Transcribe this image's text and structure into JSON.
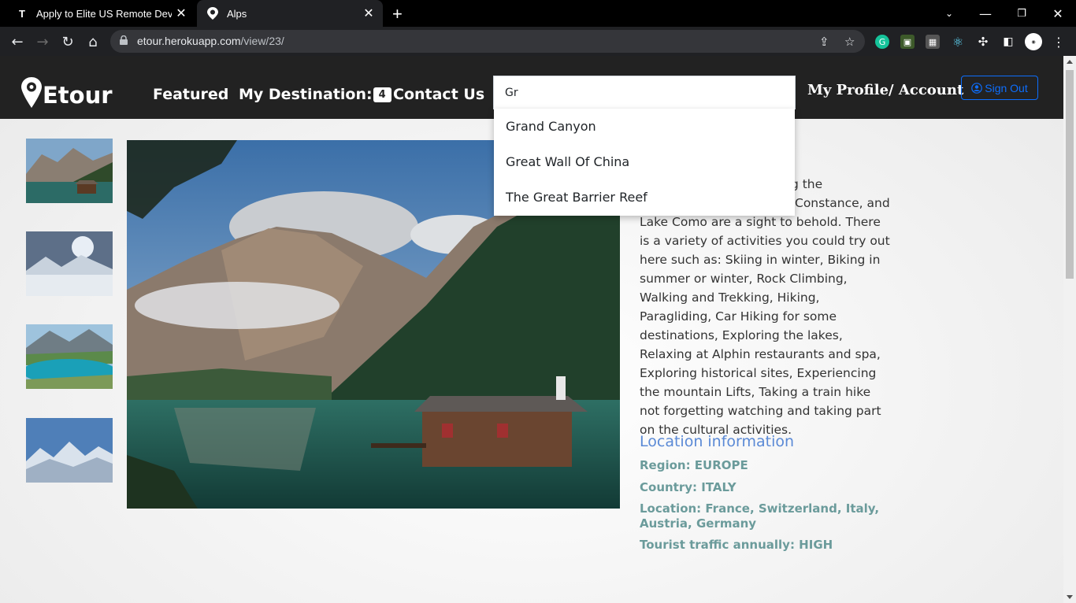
{
  "browser": {
    "tabs": [
      {
        "title": "Apply to Elite US Remote Developer Jobs",
        "favicon": "T"
      },
      {
        "title": "Alps",
        "favicon": "pin"
      }
    ],
    "url_host": "etour.herokuapp.com",
    "url_path": "/view/23/"
  },
  "navbar": {
    "brand": "Etour",
    "featured": "Featured",
    "my_destination": "My Destination:",
    "destination_count": "4",
    "contact": "Contact Us",
    "profile": "My Profile/ Account",
    "signout": "Sign Out"
  },
  "search": {
    "value": "Gr",
    "suggestions": [
      "Grand Canyon",
      "Great Wall Of China",
      "The Great Barrier Reef"
    ]
  },
  "description": {
    "line1_tail": "ding the",
    "line2_tail": "Constance, and",
    "body": "Lake Como are a sight to behold. There is a variety of activities you could try out here such as: Skiing in winter, Biking in summer or winter, Rock Climbing, Walking and Trekking, Hiking, Paragliding, Car Hiking for some destinations, Exploring the lakes, Relaxing at Alphin restaurants and spa, Exploring historical sites, Experiencing the mountain Lifts, Taking a train hike not forgetting watching and taking part on the cultural activities."
  },
  "location": {
    "title": "Location information",
    "region": "Region: EUROPE",
    "country": "Country: ITALY",
    "location": "Location: France, Switzerland, Italy, Austria, Germany",
    "traffic": "Tourist traffic annually: HIGH"
  },
  "colors": {
    "navbar_bg": "#222222",
    "signout": "#0d6efd",
    "info_title": "#5b8ad6",
    "info_text": "#6b9b9b"
  }
}
